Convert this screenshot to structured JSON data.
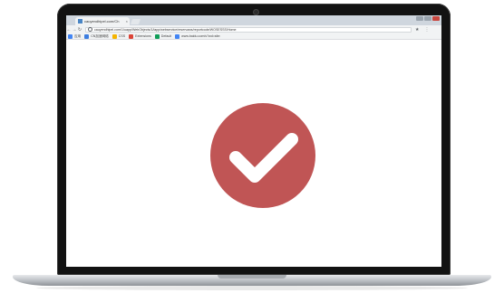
{
  "device": "laptop",
  "browser": {
    "tab": {
      "title": "cauyendhipel.com/Ch",
      "close": "×"
    },
    "address": {
      "url": "cauyendhipel.com/1/uapp/WebObjects/1/iapp/webservice/reservaws/reportcode/WOSESSS/Home",
      "back": "←",
      "forward": "→",
      "reload": "↻",
      "star": "★",
      "menu": "⋮"
    },
    "bookmarks": [
      {
        "label": "应用",
        "color": "#4285f4"
      },
      {
        "label": "CN加速网络",
        "color": "#3b7de0"
      },
      {
        "label": "CSS",
        "color": "#f4b400"
      },
      {
        "label": "Extensions",
        "color": "#db4437"
      },
      {
        "label": "Default",
        "color": "#0f9d58"
      },
      {
        "label": "www.baidu.com/s?wd=site:",
        "color": "#4285f4"
      }
    ]
  },
  "content": {
    "icon": "checkmark-circle-icon",
    "circle_color": "#c05555",
    "check_color": "#ffffff"
  }
}
